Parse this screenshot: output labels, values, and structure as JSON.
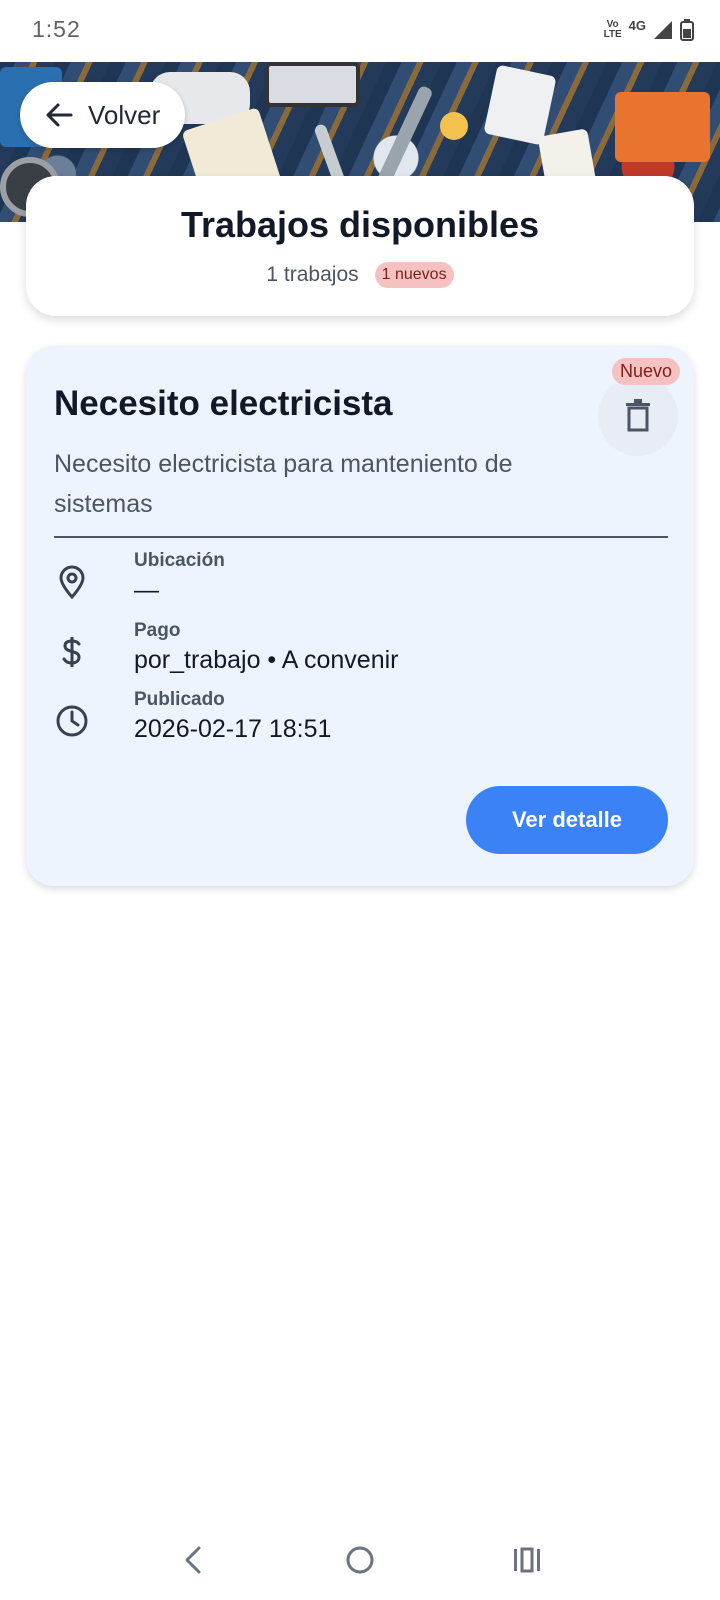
{
  "status_bar": {
    "time": "1:52",
    "volte_top": "Vo",
    "volte_bottom": "LTE",
    "network": "4G"
  },
  "header": {
    "back_label": "Volver",
    "title": "Trabajos disponibles",
    "count_text": "1 trabajos",
    "new_count_text": "1 nuevos"
  },
  "job": {
    "title": "Necesito electricista",
    "badge": "Nuevo",
    "description": "Necesito electricista para manteniento de sistemas",
    "location_label": "Ubicación",
    "location_value": "—",
    "payment_label": "Pago",
    "payment_value": "por_trabajo • A convenir",
    "published_label": "Publicado",
    "published_value": "2026-02-17 18:51",
    "detail_button": "Ver detalle"
  },
  "colors": {
    "primary": "#3b82f6",
    "card_bg": "#eef4fd",
    "badge_bg": "#f5c2c2",
    "badge_text": "#7f1d1d"
  },
  "icons": {
    "back": "arrow-left-icon",
    "delete": "trash-icon",
    "location": "map-pin-icon",
    "payment": "dollar-icon",
    "published": "clock-icon"
  }
}
